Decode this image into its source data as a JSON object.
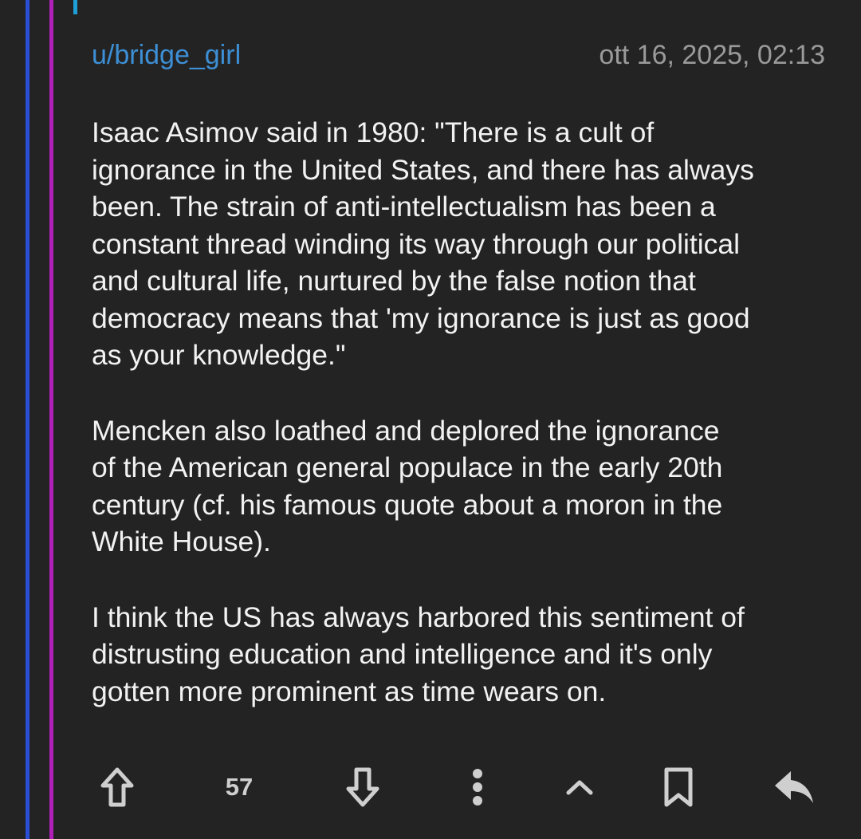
{
  "comment": {
    "username": "u/bridge_girl",
    "timestamp": "ott 16, 2025, 02:13",
    "paragraphs": [
      "Isaac Asimov said in 1980: \"There is a cult of\nignorance in the United States, and there has always\nbeen. The strain of anti-intellectualism has been a\nconstant thread winding its way through our political\nand cultural life, nurtured by the false notion that\ndemocracy means that 'my ignorance is just as good\nas your knowledge.\"",
      "Mencken also loathed and deplored the ignorance\nof the American general populace in the early 20th\ncentury (cf. his famous quote about a moron in the\nWhite House).",
      "I think the US has always harbored this sentiment of\ndistrusting education and intelligence and it's only\ngotten more prominent as time wears on."
    ],
    "score": "57"
  },
  "icons": {
    "upvote": "upvote-icon",
    "downvote": "downvote-icon",
    "more": "more-vertical-icon",
    "collapse": "chevron-up-icon",
    "save": "bookmark-icon",
    "reply": "reply-icon"
  },
  "colors": {
    "background": "#232323",
    "username": "#3d8fd6",
    "timestamp": "#9a9a9a",
    "text": "#f2f2f2",
    "icon": "#cfcfcf",
    "thread_line_1": "#2a4fd6",
    "thread_line_2": "#b020b8",
    "thread_line_3": "#1e9fd6"
  }
}
